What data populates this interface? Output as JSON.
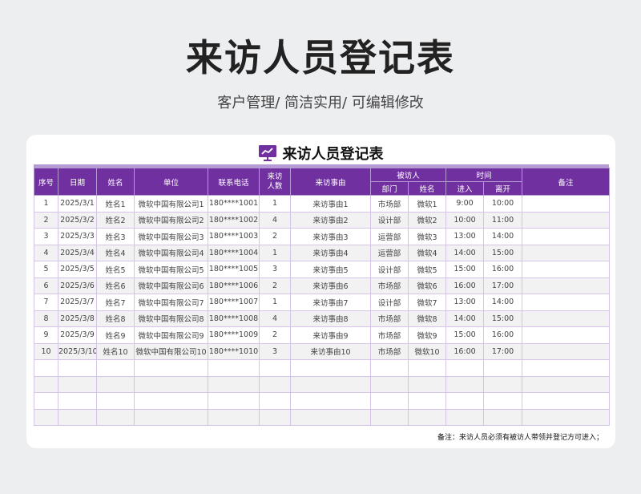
{
  "page": {
    "title": "来访人员登记表",
    "subtitle": "客户管理/ 简洁实用/ 可编辑修改"
  },
  "card": {
    "title": "来访人员登记表",
    "icon": "presentation-chart-icon",
    "accent": "#7030a0"
  },
  "table": {
    "headers": {
      "seq": "序号",
      "date": "日期",
      "name": "姓名",
      "unit": "单位",
      "phone": "联系电话",
      "count": "来访人数",
      "reason": "来访事由",
      "visitee": "被访人",
      "dept": "部门",
      "visitee_name": "姓名",
      "time": "时间",
      "enter": "进入",
      "leave": "离开",
      "remark": "备注"
    },
    "rows": [
      {
        "seq": "1",
        "date": "2025/3/1",
        "name": "姓名1",
        "unit": "微软中国有限公司1",
        "phone": "180****1001",
        "count": "1",
        "reason": "来访事由1",
        "dept": "市场部",
        "vname": "微软1",
        "enter": "9:00",
        "leave": "10:00",
        "remark": ""
      },
      {
        "seq": "2",
        "date": "2025/3/2",
        "name": "姓名2",
        "unit": "微软中国有限公司2",
        "phone": "180****1002",
        "count": "4",
        "reason": "来访事由2",
        "dept": "设计部",
        "vname": "微软2",
        "enter": "10:00",
        "leave": "11:00",
        "remark": ""
      },
      {
        "seq": "3",
        "date": "2025/3/3",
        "name": "姓名3",
        "unit": "微软中国有限公司3",
        "phone": "180****1003",
        "count": "2",
        "reason": "来访事由3",
        "dept": "运营部",
        "vname": "微软3",
        "enter": "13:00",
        "leave": "14:00",
        "remark": ""
      },
      {
        "seq": "4",
        "date": "2025/3/4",
        "name": "姓名4",
        "unit": "微软中国有限公司4",
        "phone": "180****1004",
        "count": "1",
        "reason": "来访事由4",
        "dept": "运营部",
        "vname": "微软4",
        "enter": "14:00",
        "leave": "15:00",
        "remark": ""
      },
      {
        "seq": "5",
        "date": "2025/3/5",
        "name": "姓名5",
        "unit": "微软中国有限公司5",
        "phone": "180****1005",
        "count": "3",
        "reason": "来访事由5",
        "dept": "设计部",
        "vname": "微软5",
        "enter": "15:00",
        "leave": "16:00",
        "remark": ""
      },
      {
        "seq": "6",
        "date": "2025/3/6",
        "name": "姓名6",
        "unit": "微软中国有限公司6",
        "phone": "180****1006",
        "count": "2",
        "reason": "来访事由6",
        "dept": "市场部",
        "vname": "微软6",
        "enter": "16:00",
        "leave": "17:00",
        "remark": ""
      },
      {
        "seq": "7",
        "date": "2025/3/7",
        "name": "姓名7",
        "unit": "微软中国有限公司7",
        "phone": "180****1007",
        "count": "1",
        "reason": "来访事由7",
        "dept": "设计部",
        "vname": "微软7",
        "enter": "13:00",
        "leave": "14:00",
        "remark": ""
      },
      {
        "seq": "8",
        "date": "2025/3/8",
        "name": "姓名8",
        "unit": "微软中国有限公司8",
        "phone": "180****1008",
        "count": "4",
        "reason": "来访事由8",
        "dept": "市场部",
        "vname": "微软8",
        "enter": "14:00",
        "leave": "15:00",
        "remark": ""
      },
      {
        "seq": "9",
        "date": "2025/3/9",
        "name": "姓名9",
        "unit": "微软中国有限公司9",
        "phone": "180****1009",
        "count": "2",
        "reason": "来访事由9",
        "dept": "市场部",
        "vname": "微软9",
        "enter": "15:00",
        "leave": "16:00",
        "remark": ""
      },
      {
        "seq": "10",
        "date": "2025/3/10",
        "name": "姓名10",
        "unit": "微软中国有限公司10",
        "phone": "180****1010",
        "count": "3",
        "reason": "来访事由10",
        "dept": "市场部",
        "vname": "微软10",
        "enter": "16:00",
        "leave": "17:00",
        "remark": ""
      },
      {
        "seq": "",
        "date": "",
        "name": "",
        "unit": "",
        "phone": "",
        "count": "",
        "reason": "",
        "dept": "",
        "vname": "",
        "enter": "",
        "leave": "",
        "remark": ""
      },
      {
        "seq": "",
        "date": "",
        "name": "",
        "unit": "",
        "phone": "",
        "count": "",
        "reason": "",
        "dept": "",
        "vname": "",
        "enter": "",
        "leave": "",
        "remark": ""
      },
      {
        "seq": "",
        "date": "",
        "name": "",
        "unit": "",
        "phone": "",
        "count": "",
        "reason": "",
        "dept": "",
        "vname": "",
        "enter": "",
        "leave": "",
        "remark": ""
      },
      {
        "seq": "",
        "date": "",
        "name": "",
        "unit": "",
        "phone": "",
        "count": "",
        "reason": "",
        "dept": "",
        "vname": "",
        "enter": "",
        "leave": "",
        "remark": ""
      }
    ]
  },
  "note": "备注：来访人员必须有被访人带领并登记方可进入；"
}
